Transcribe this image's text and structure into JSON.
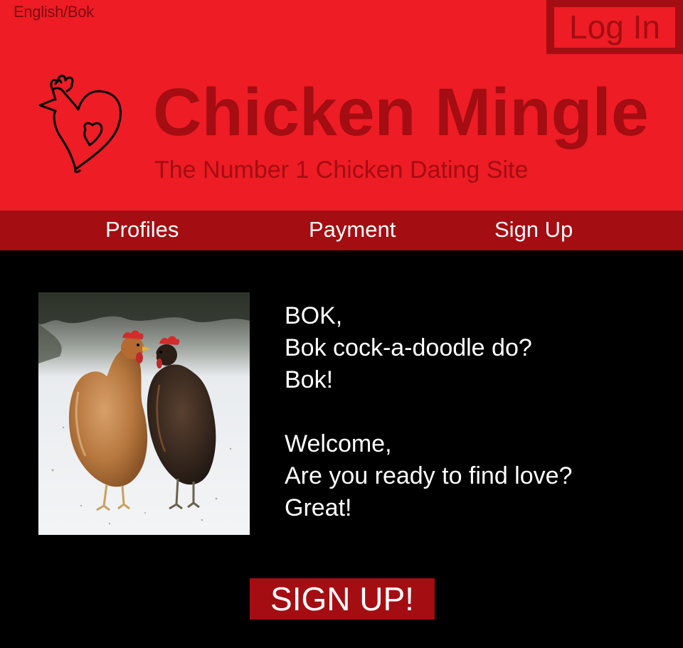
{
  "header": {
    "language_toggle": "English/Bok",
    "login_label": "Log In",
    "title": "Chicken Mingle",
    "tagline": "The Number 1 Chicken Dating Site"
  },
  "nav": {
    "items": [
      {
        "label": "Profiles"
      },
      {
        "label": "Payment"
      },
      {
        "label": "Sign Up"
      }
    ]
  },
  "main": {
    "greeting_lines": [
      "BOK,",
      "Bok cock-a-doodle do?",
      "Bok!"
    ],
    "welcome_lines": [
      "Welcome,",
      "Are you ready to find love?",
      "Great!"
    ],
    "cta_label": "SIGN UP!"
  },
  "icons": {
    "logo": "chicken-heart-logo"
  },
  "colors": {
    "header_bg": "#ee1c25",
    "accent_dark": "#a40d12",
    "page_bg": "#000000",
    "text_light": "#ffffff"
  }
}
